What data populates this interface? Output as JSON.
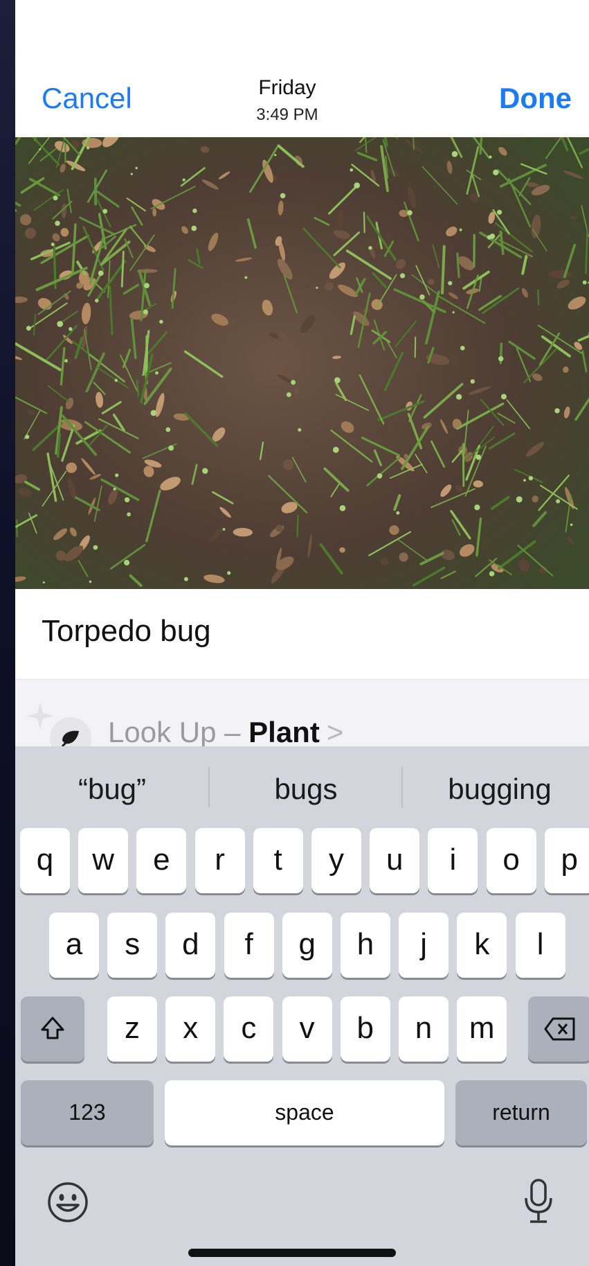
{
  "nav": {
    "cancel_label": "Cancel",
    "done_label": "Done",
    "date_day": "Friday",
    "date_time": "3:49 PM"
  },
  "caption": "Torpedo bug",
  "lookup": {
    "prefix": "Look Up – ",
    "subject": "Plant",
    "chevron": ">",
    "icon": "leaf-icon",
    "sparkle": "sparkle-icon"
  },
  "keyboard": {
    "suggestions": [
      "“bug”",
      "bugs",
      "bugging"
    ],
    "row1": [
      "q",
      "w",
      "e",
      "r",
      "t",
      "y",
      "u",
      "i",
      "o",
      "p"
    ],
    "row2": [
      "a",
      "s",
      "d",
      "f",
      "g",
      "h",
      "j",
      "k",
      "l"
    ],
    "row3": [
      "z",
      "x",
      "c",
      "v",
      "b",
      "n",
      "m"
    ],
    "numbers_label": "123",
    "space_label": "space",
    "return_label": "return",
    "shift_icon": "shift-icon",
    "delete_icon": "delete-icon",
    "emoji_icon": "emoji-icon",
    "mic_icon": "microphone-icon"
  },
  "colors": {
    "accent": "#1a7cf5",
    "keyboard_bg": "#d2d5dc",
    "key_bg": "#ffffff",
    "dark_key_bg": "#abb0bb"
  }
}
